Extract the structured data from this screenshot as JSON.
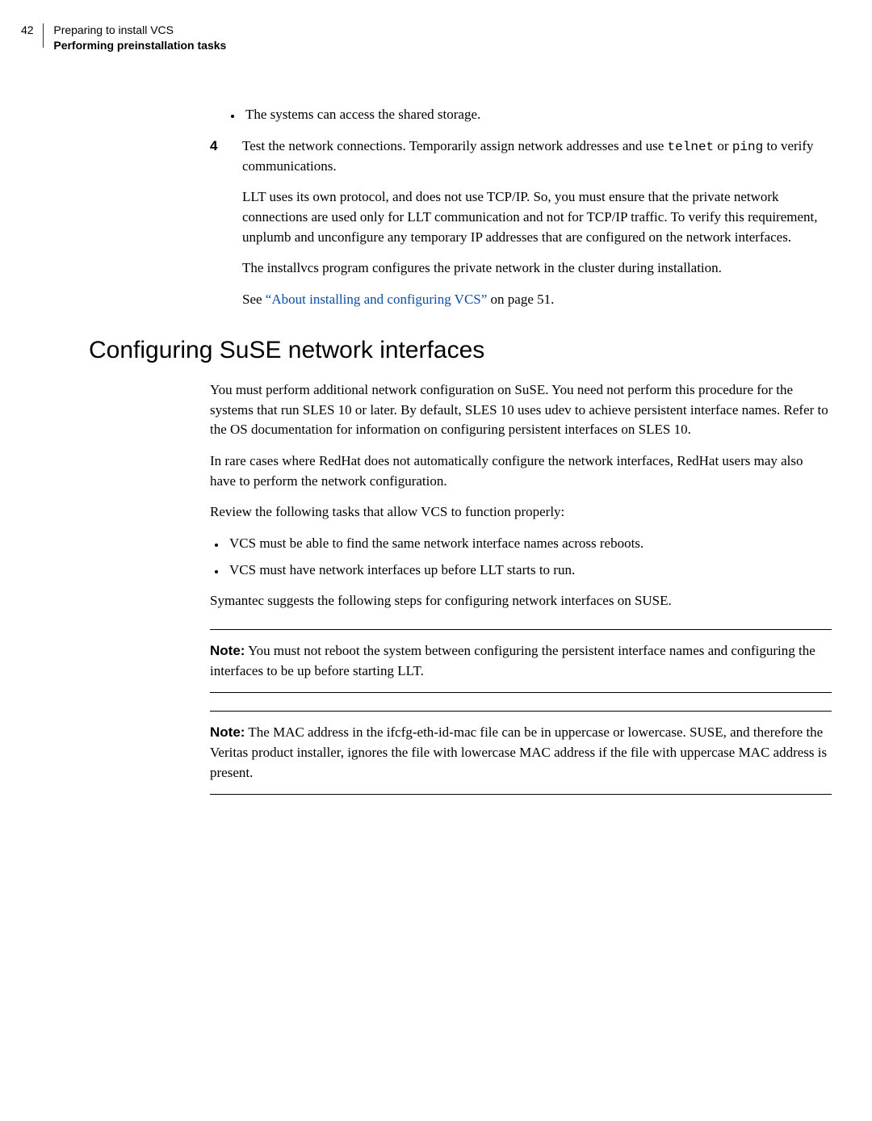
{
  "header": {
    "page_number": "42",
    "chapter": "Preparing to install VCS",
    "section": "Performing preinstallation tasks"
  },
  "bullets_top": [
    "The systems can access the shared storage."
  ],
  "step4": {
    "number": "4",
    "lead": "Test the network connections. Temporarily assign network addresses and use ",
    "code1": "telnet",
    "mid": " or ",
    "code2": "ping",
    "tail": " to verify communications.",
    "p2": "LLT uses its own protocol, and does not use TCP/IP. So, you must ensure that the private network connections are used only for LLT communication and not for TCP/IP traffic. To verify this requirement, unplumb and unconfigure any temporary IP addresses that are configured on the network interfaces.",
    "p3": "The installvcs program configures the private network in the cluster during installation.",
    "see_pre": "See ",
    "see_link": "“About installing and configuring VCS”",
    "see_post": " on page 51."
  },
  "heading": "Configuring SuSE network interfaces",
  "body": {
    "p1": "You must perform additional network configuration on SuSE. You need not perform this procedure for the systems that run SLES 10 or later. By default, SLES 10 uses udev to achieve persistent interface names. Refer to the OS documentation for information on configuring persistent interfaces on SLES 10.",
    "p2": "In rare cases where RedHat does not automatically configure the network interfaces, RedHat users may also have to perform the network configuration.",
    "p3": "Review the following tasks that allow VCS to function properly:",
    "bullets": [
      "VCS must be able to find the same network interface names across reboots.",
      "VCS must have network interfaces up before LLT starts to run."
    ],
    "p4": "Symantec suggests the following steps for configuring network interfaces on SUSE."
  },
  "note1": {
    "label": "Note:",
    "text": " You must not reboot the system between configuring the persistent interface names and configuring the interfaces to be up before starting LLT."
  },
  "note2": {
    "label": "Note:",
    "text": " The MAC address in the ifcfg-eth-id-mac file can be in uppercase or lowercase. SUSE, and therefore the Veritas product installer, ignores the file with lowercase MAC address if the file with uppercase MAC address is present."
  }
}
